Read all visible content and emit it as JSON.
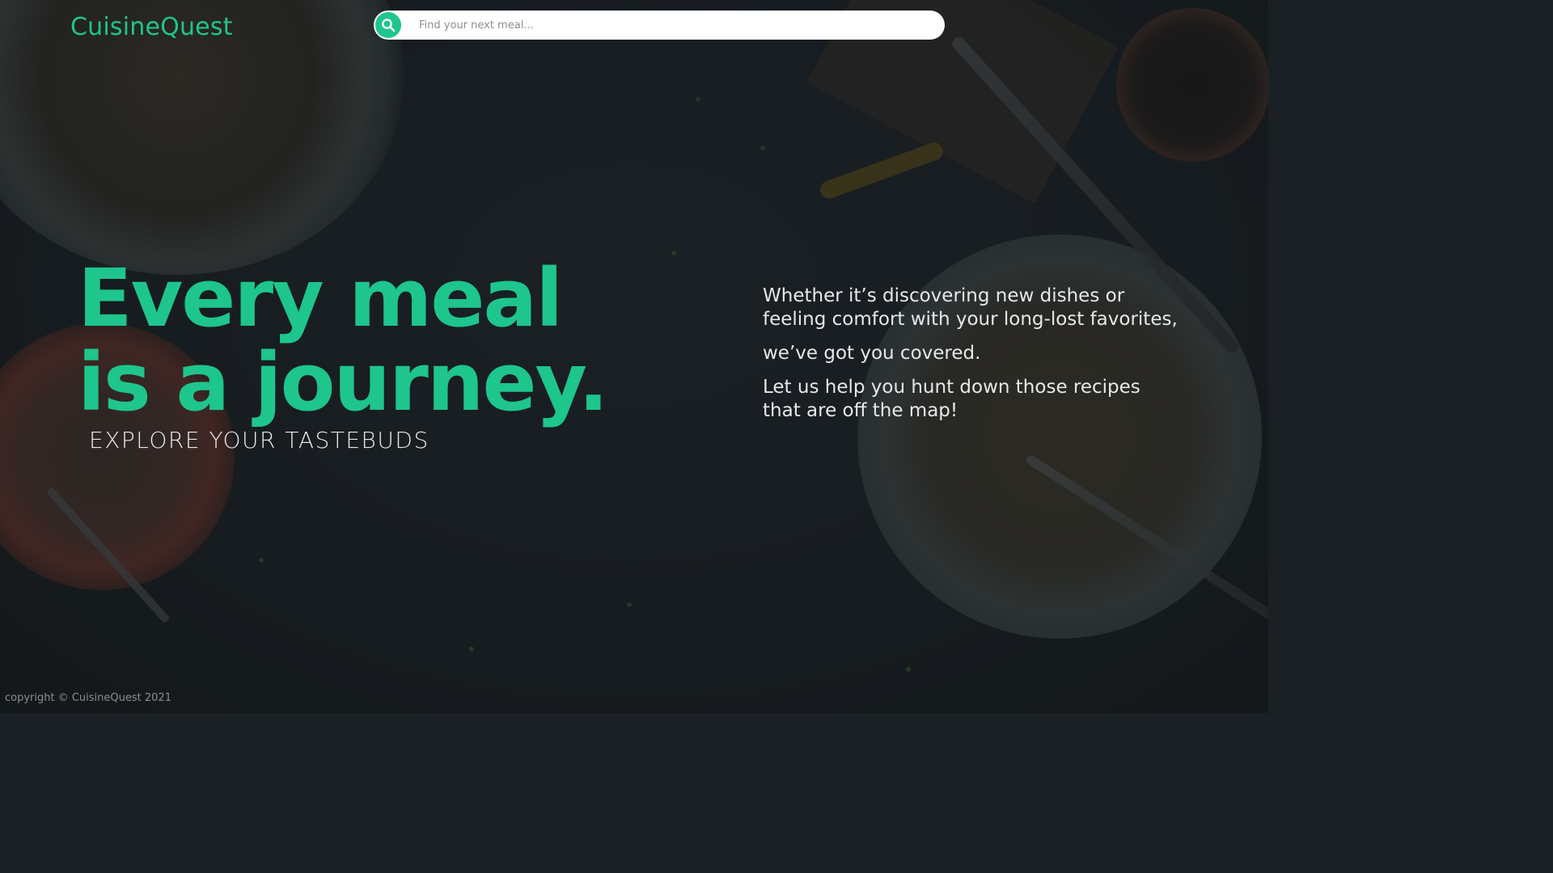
{
  "brand": {
    "name": "CuisineQuest",
    "accent_color": "#1ec58c"
  },
  "search": {
    "placeholder": "Find your next meal...",
    "icon": "search-icon"
  },
  "hero": {
    "title_line1": "Every meal",
    "title_line2": "is a journey.",
    "tagline": "EXPLORE YOUR TASTEBUDS"
  },
  "intro": {
    "paragraph1": "Whether it’s discovering new dishes or feeling comfort with your long-lost favorites,",
    "paragraph2": "we’ve got you covered.",
    "paragraph3": "Let us help you hunt down those recipes that are off the map!"
  },
  "footer": {
    "copyright": "copyright © CuisineQuest 2021"
  }
}
